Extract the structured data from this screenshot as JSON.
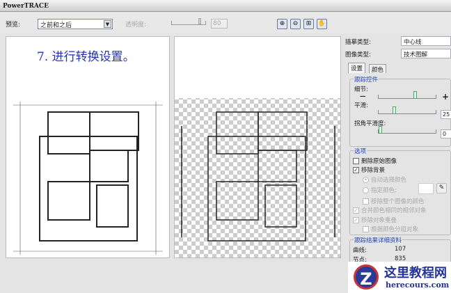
{
  "window": {
    "title": "PowerTRACE"
  },
  "toolbar": {
    "preview_label": "预览:",
    "preview_value": "之前和之后",
    "transparency_label": "透明度:",
    "transparency_value": "80",
    "zoom_in": "zoom-in",
    "zoom_out": "zoom-out",
    "fit": "fit",
    "pan": "pan"
  },
  "canvas": {
    "step_text": "7. 进行转换设置。"
  },
  "panel": {
    "trace_type_label": "描摹类型:",
    "trace_type_value": "中心线",
    "image_type_label": "图像类型:",
    "image_type_value": "技术图解",
    "tabs": [
      "设置",
      "颜色"
    ],
    "trace_controls": {
      "title": "跟踪控件",
      "detail_label": "细节:",
      "detail_level": 0.62,
      "smoothing_label": "平滑:",
      "smoothing_value": "25",
      "corner_label": "拐角平滑度:",
      "corner_value": "0"
    },
    "options": {
      "title": "选项",
      "items": [
        {
          "label": "删除原始图像",
          "checked": false,
          "enabled": true
        },
        {
          "label": "移除背景",
          "checked": true,
          "enabled": true
        },
        {
          "label": "自动选择颜色",
          "type": "radio",
          "checked": true,
          "enabled": false
        },
        {
          "label": "指定颜色:",
          "type": "radio",
          "checked": false,
          "enabled": false
        },
        {
          "label": "移除整个图像的颜色",
          "checked": false,
          "enabled": false
        },
        {
          "label": "合并颜色相同的相邻对象",
          "checked": true,
          "enabled": false
        },
        {
          "label": "移除对象重叠",
          "checked": true,
          "enabled": false
        },
        {
          "label": "根据颜色分组对象",
          "checked": false,
          "enabled": false
        }
      ]
    },
    "results": {
      "title": "跟踪结果详细资料",
      "curves_label": "曲线:",
      "curves_value": "107",
      "nodes_label": "节点:",
      "nodes_value": "835"
    }
  },
  "watermark": {
    "name": "这里教程网",
    "url": "herecours.com"
  }
}
